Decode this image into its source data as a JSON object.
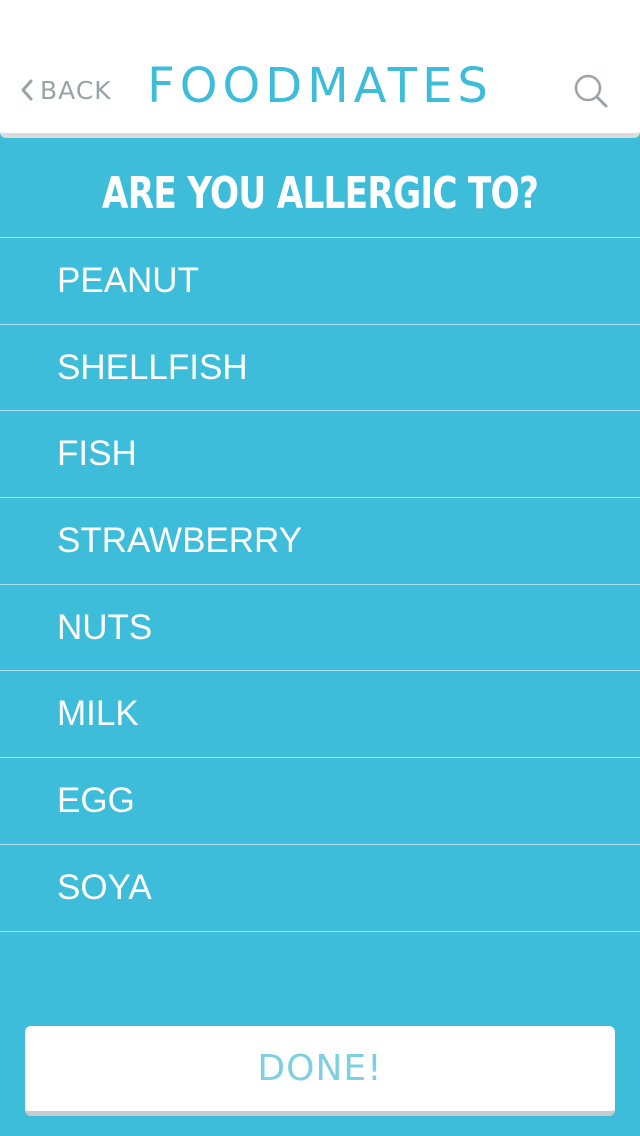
{
  "header": {
    "back_label": "BACK",
    "title": "FOODMATES",
    "back_icon": "chevron-left-icon",
    "search_icon": "search-icon"
  },
  "question": "ARE YOU ALLERGIC TO?",
  "allergens": [
    "PEANUT",
    "SHELLFISH",
    "FISH",
    "STRAWBERRY",
    "NUTS",
    "MILK",
    "EGG",
    "SOYA"
  ],
  "done_label": "DONE!",
  "colors": {
    "accent": "#3dbdd9",
    "header_bg": "#ffffff",
    "muted": "#9aa3a6",
    "done_text": "#7ecfe2"
  }
}
